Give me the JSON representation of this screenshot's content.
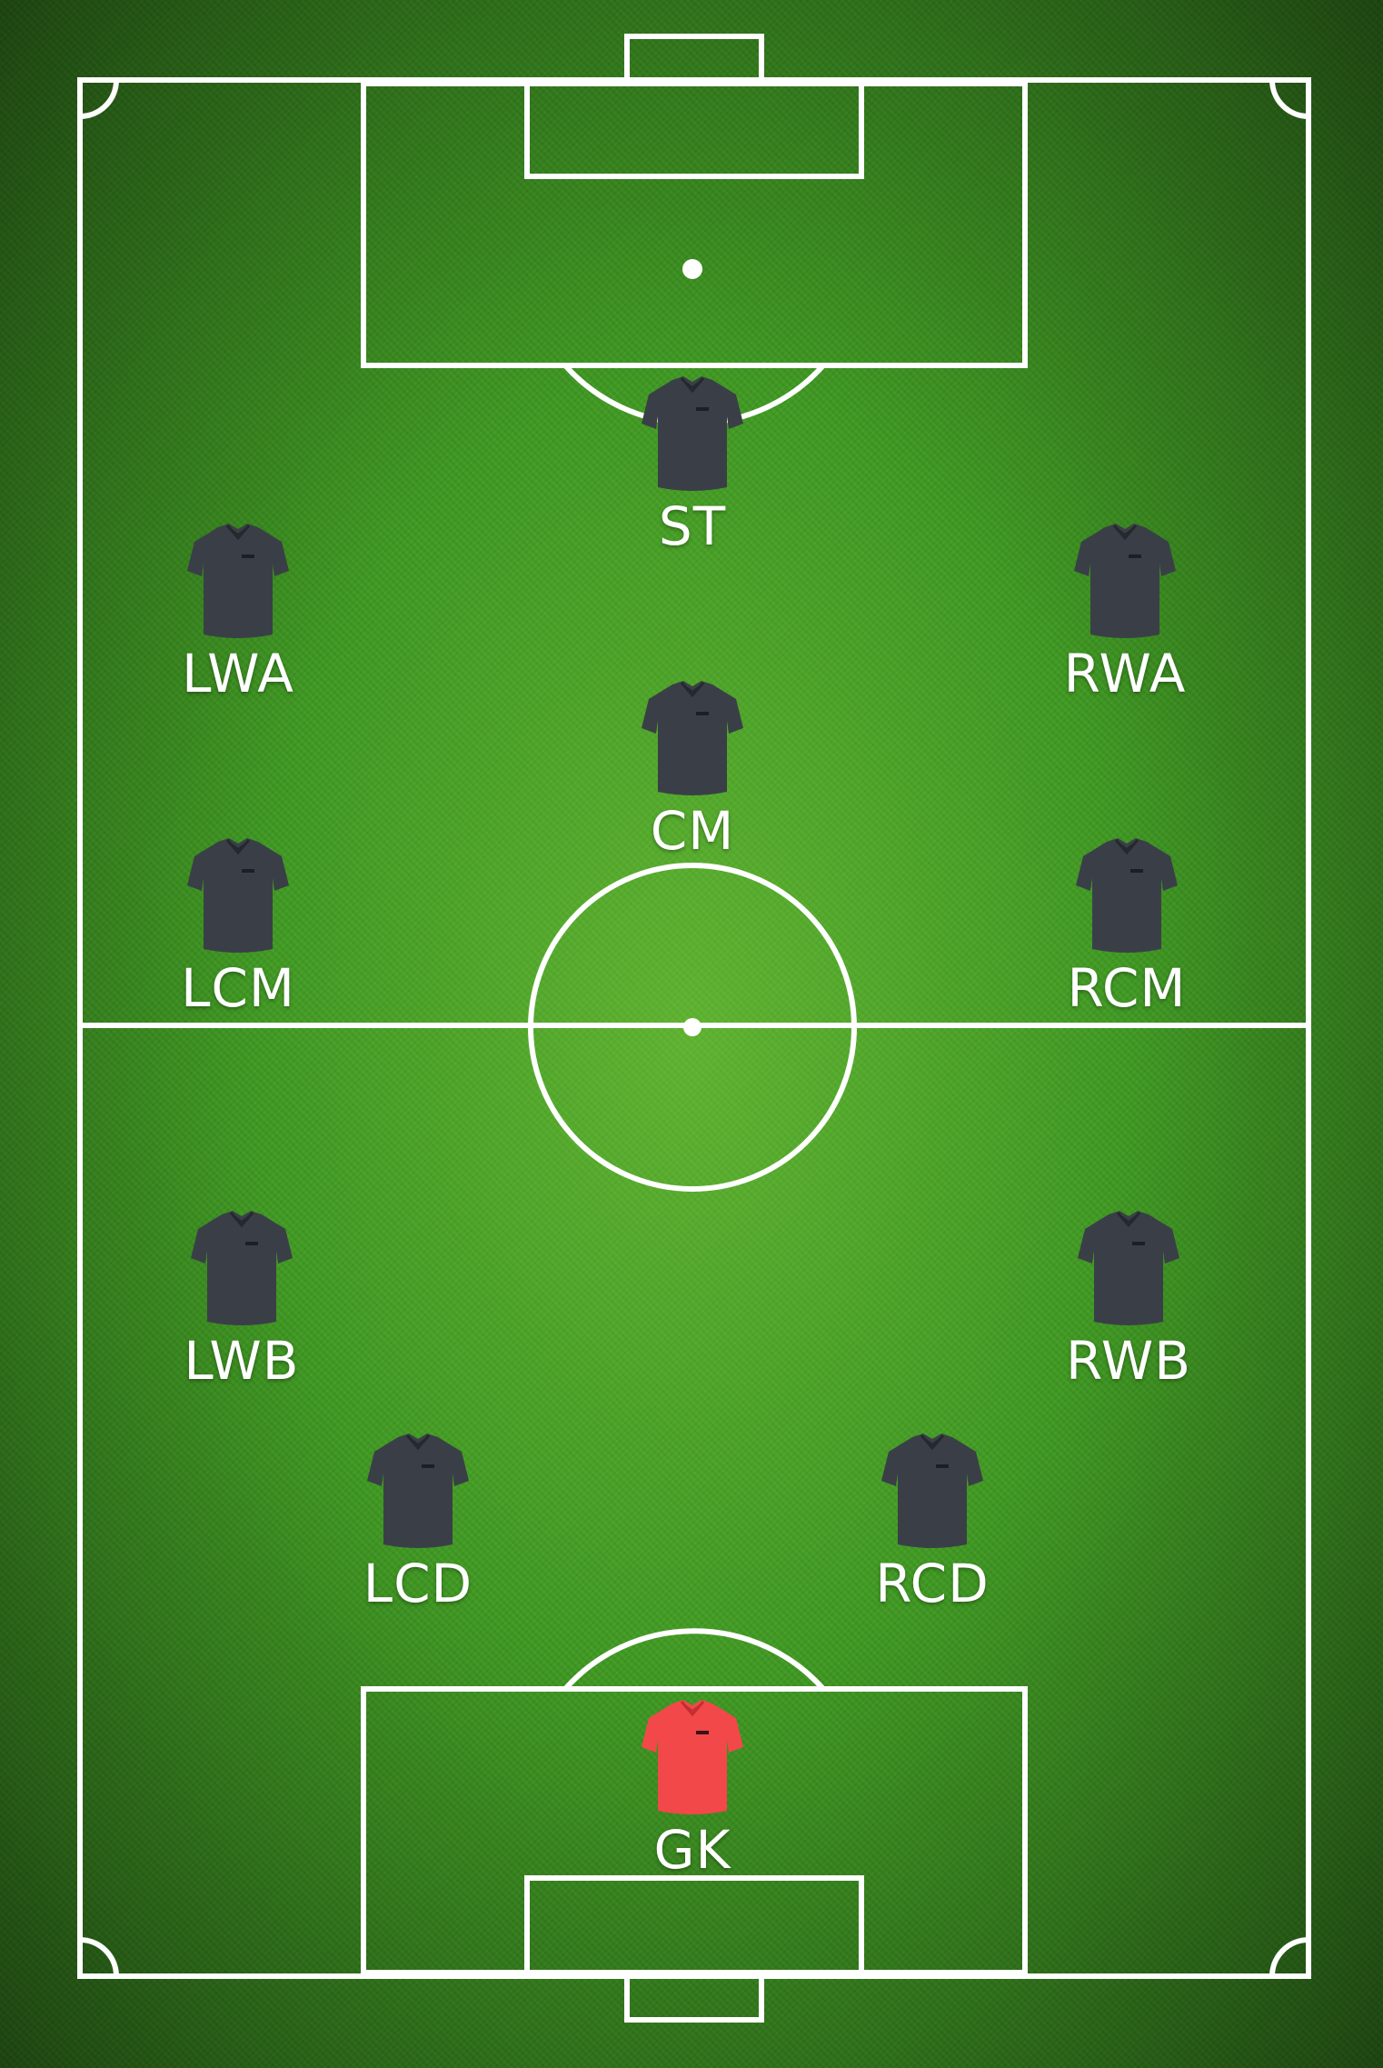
{
  "colors": {
    "grass": "#3f9a22",
    "line": "#ffffff",
    "outfield_shirt": "#3a3f47",
    "goalkeeper_shirt": "#f2484a"
  },
  "players": [
    {
      "id": "st",
      "label": "ST",
      "role": "outfield",
      "icon": "shirt-icon"
    },
    {
      "id": "lwa",
      "label": "LWA",
      "role": "outfield",
      "icon": "shirt-icon"
    },
    {
      "id": "rwa",
      "label": "RWA",
      "role": "outfield",
      "icon": "shirt-icon"
    },
    {
      "id": "cm",
      "label": "CM",
      "role": "outfield",
      "icon": "shirt-icon"
    },
    {
      "id": "lcm",
      "label": "LCM",
      "role": "outfield",
      "icon": "shirt-icon"
    },
    {
      "id": "rcm",
      "label": "RCM",
      "role": "outfield",
      "icon": "shirt-icon"
    },
    {
      "id": "lwb",
      "label": "LWB",
      "role": "outfield",
      "icon": "shirt-icon"
    },
    {
      "id": "rwb",
      "label": "RWB",
      "role": "outfield",
      "icon": "shirt-icon"
    },
    {
      "id": "lcd",
      "label": "LCD",
      "role": "outfield",
      "icon": "shirt-icon"
    },
    {
      "id": "rcd",
      "label": "RCD",
      "role": "outfield",
      "icon": "shirt-icon"
    },
    {
      "id": "gk",
      "label": "GK",
      "role": "goalkeeper",
      "icon": "shirt-icon"
    }
  ]
}
